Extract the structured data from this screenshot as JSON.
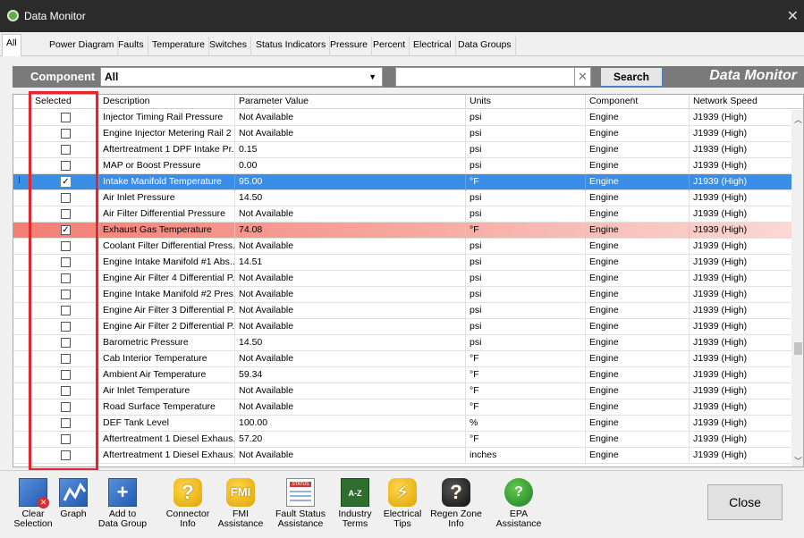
{
  "window": {
    "title": "Data Monitor"
  },
  "tabs": [
    {
      "label": "All"
    },
    {
      "label": "Power Diagram"
    },
    {
      "label": "Faults"
    },
    {
      "label": "Temperature"
    },
    {
      "label": "Switches"
    },
    {
      "label": "Status Indicators"
    },
    {
      "label": "Pressure"
    },
    {
      "label": "Percent"
    },
    {
      "label": "Electrical"
    },
    {
      "label": "Data Groups"
    }
  ],
  "filter": {
    "component_label": "Component",
    "component_value": "All",
    "search_value": "",
    "search_button": "Search",
    "brand": "Data Monitor"
  },
  "grid": {
    "headers": {
      "selected": "Selected",
      "description": "Description",
      "value": "Parameter Value",
      "units": "Units",
      "component": "Component",
      "network": "Network Speed",
      "sort_mark": "/"
    },
    "rows": [
      {
        "checked": false,
        "description": "Injector Timing Rail Pressure",
        "value": "Not Available",
        "units": "psi",
        "component": "Engine",
        "network": "J1939 (High)"
      },
      {
        "checked": false,
        "description": "Engine Injector Metering Rail 2 ...",
        "value": "Not Available",
        "units": "psi",
        "component": "Engine",
        "network": "J1939 (High)"
      },
      {
        "checked": false,
        "description": "Aftertreatment 1 DPF Intake Pr...",
        "value": "0.15",
        "units": "psi",
        "component": "Engine",
        "network": "J1939 (High)"
      },
      {
        "checked": false,
        "description": "MAP or Boost Pressure",
        "value": "0.00",
        "units": "psi",
        "component": "Engine",
        "network": "J1939 (High)"
      },
      {
        "checked": true,
        "description": "Intake Manifold Temperature",
        "value": "95.00",
        "units": "°F",
        "component": "Engine",
        "network": "J1939 (High)"
      },
      {
        "checked": false,
        "description": "Air Inlet Pressure",
        "value": "14.50",
        "units": "psi",
        "component": "Engine",
        "network": "J1939 (High)"
      },
      {
        "checked": false,
        "description": "Air Filter Differential Pressure",
        "value": "Not Available",
        "units": "psi",
        "component": "Engine",
        "network": "J1939 (High)"
      },
      {
        "checked": true,
        "description": "Exhaust Gas Temperature",
        "value": "74.08",
        "units": "°F",
        "component": "Engine",
        "network": "J1939 (High)"
      },
      {
        "checked": false,
        "description": "Coolant Filter Differential Press...",
        "value": "Not Available",
        "units": "psi",
        "component": "Engine",
        "network": "J1939 (High)"
      },
      {
        "checked": false,
        "description": "Engine Intake Manifold #1 Abs...",
        "value": "14.51",
        "units": "psi",
        "component": "Engine",
        "network": "J1939 (High)"
      },
      {
        "checked": false,
        "description": "Engine Air Filter 4 Differential P...",
        "value": "Not Available",
        "units": "psi",
        "component": "Engine",
        "network": "J1939 (High)"
      },
      {
        "checked": false,
        "description": "Engine Intake Manifold #2 Pres...",
        "value": "Not Available",
        "units": "psi",
        "component": "Engine",
        "network": "J1939 (High)"
      },
      {
        "checked": false,
        "description": "Engine Air Filter 3 Differential P...",
        "value": "Not Available",
        "units": "psi",
        "component": "Engine",
        "network": "J1939 (High)"
      },
      {
        "checked": false,
        "description": "Engine Air Filter 2 Differential P...",
        "value": "Not Available",
        "units": "psi",
        "component": "Engine",
        "network": "J1939 (High)"
      },
      {
        "checked": false,
        "description": "Barometric Pressure",
        "value": "14.50",
        "units": "psi",
        "component": "Engine",
        "network": "J1939 (High)"
      },
      {
        "checked": false,
        "description": "Cab Interior Temperature",
        "value": "Not Available",
        "units": "°F",
        "component": "Engine",
        "network": "J1939 (High)"
      },
      {
        "checked": false,
        "description": "Ambient Air Temperature",
        "value": "59.34",
        "units": "°F",
        "component": "Engine",
        "network": "J1939 (High)"
      },
      {
        "checked": false,
        "description": "Air Inlet Temperature",
        "value": "Not Available",
        "units": "°F",
        "component": "Engine",
        "network": "J1939 (High)"
      },
      {
        "checked": false,
        "description": "Road Surface Temperature",
        "value": "Not Available",
        "units": "°F",
        "component": "Engine",
        "network": "J1939 (High)"
      },
      {
        "checked": false,
        "description": "DEF Tank Level",
        "value": "100.00",
        "units": "%",
        "component": "Engine",
        "network": "J1939 (High)"
      },
      {
        "checked": false,
        "description": "Aftertreatment 1 Diesel Exhaus...",
        "value": "57.20",
        "units": "°F",
        "component": "Engine",
        "network": "J1939 (High)"
      },
      {
        "checked": false,
        "description": "Aftertreatment 1 Diesel Exhaus...",
        "value": "Not Available",
        "units": "inches",
        "component": "Engine",
        "network": "J1939 (High)"
      }
    ],
    "row_indicator": "I"
  },
  "toolbar": {
    "clear_line1": "Clear",
    "clear_line2": "Selection",
    "graph": "Graph",
    "add_line1": "Add to",
    "add_line2": "Data Group",
    "connector_line1": "Connector",
    "connector_line2": "Info",
    "fmi_icon_text": "FMI",
    "fmi_line1": "FMI",
    "fmi_line2": "Assistance",
    "status_icon_text": "STATUS",
    "fault_line1": "Fault Status",
    "fault_line2": "Assistance",
    "az_icon_text": "A-Z",
    "industry_line1": "Industry",
    "industry_line2": "Terms",
    "electrical_line1": "Electrical",
    "electrical_line2": "Tips",
    "regen_line1": "Regen Zone",
    "regen_line2": "Info",
    "epa_line1": "EPA",
    "epa_line2": "Assistance",
    "close": "Close"
  }
}
